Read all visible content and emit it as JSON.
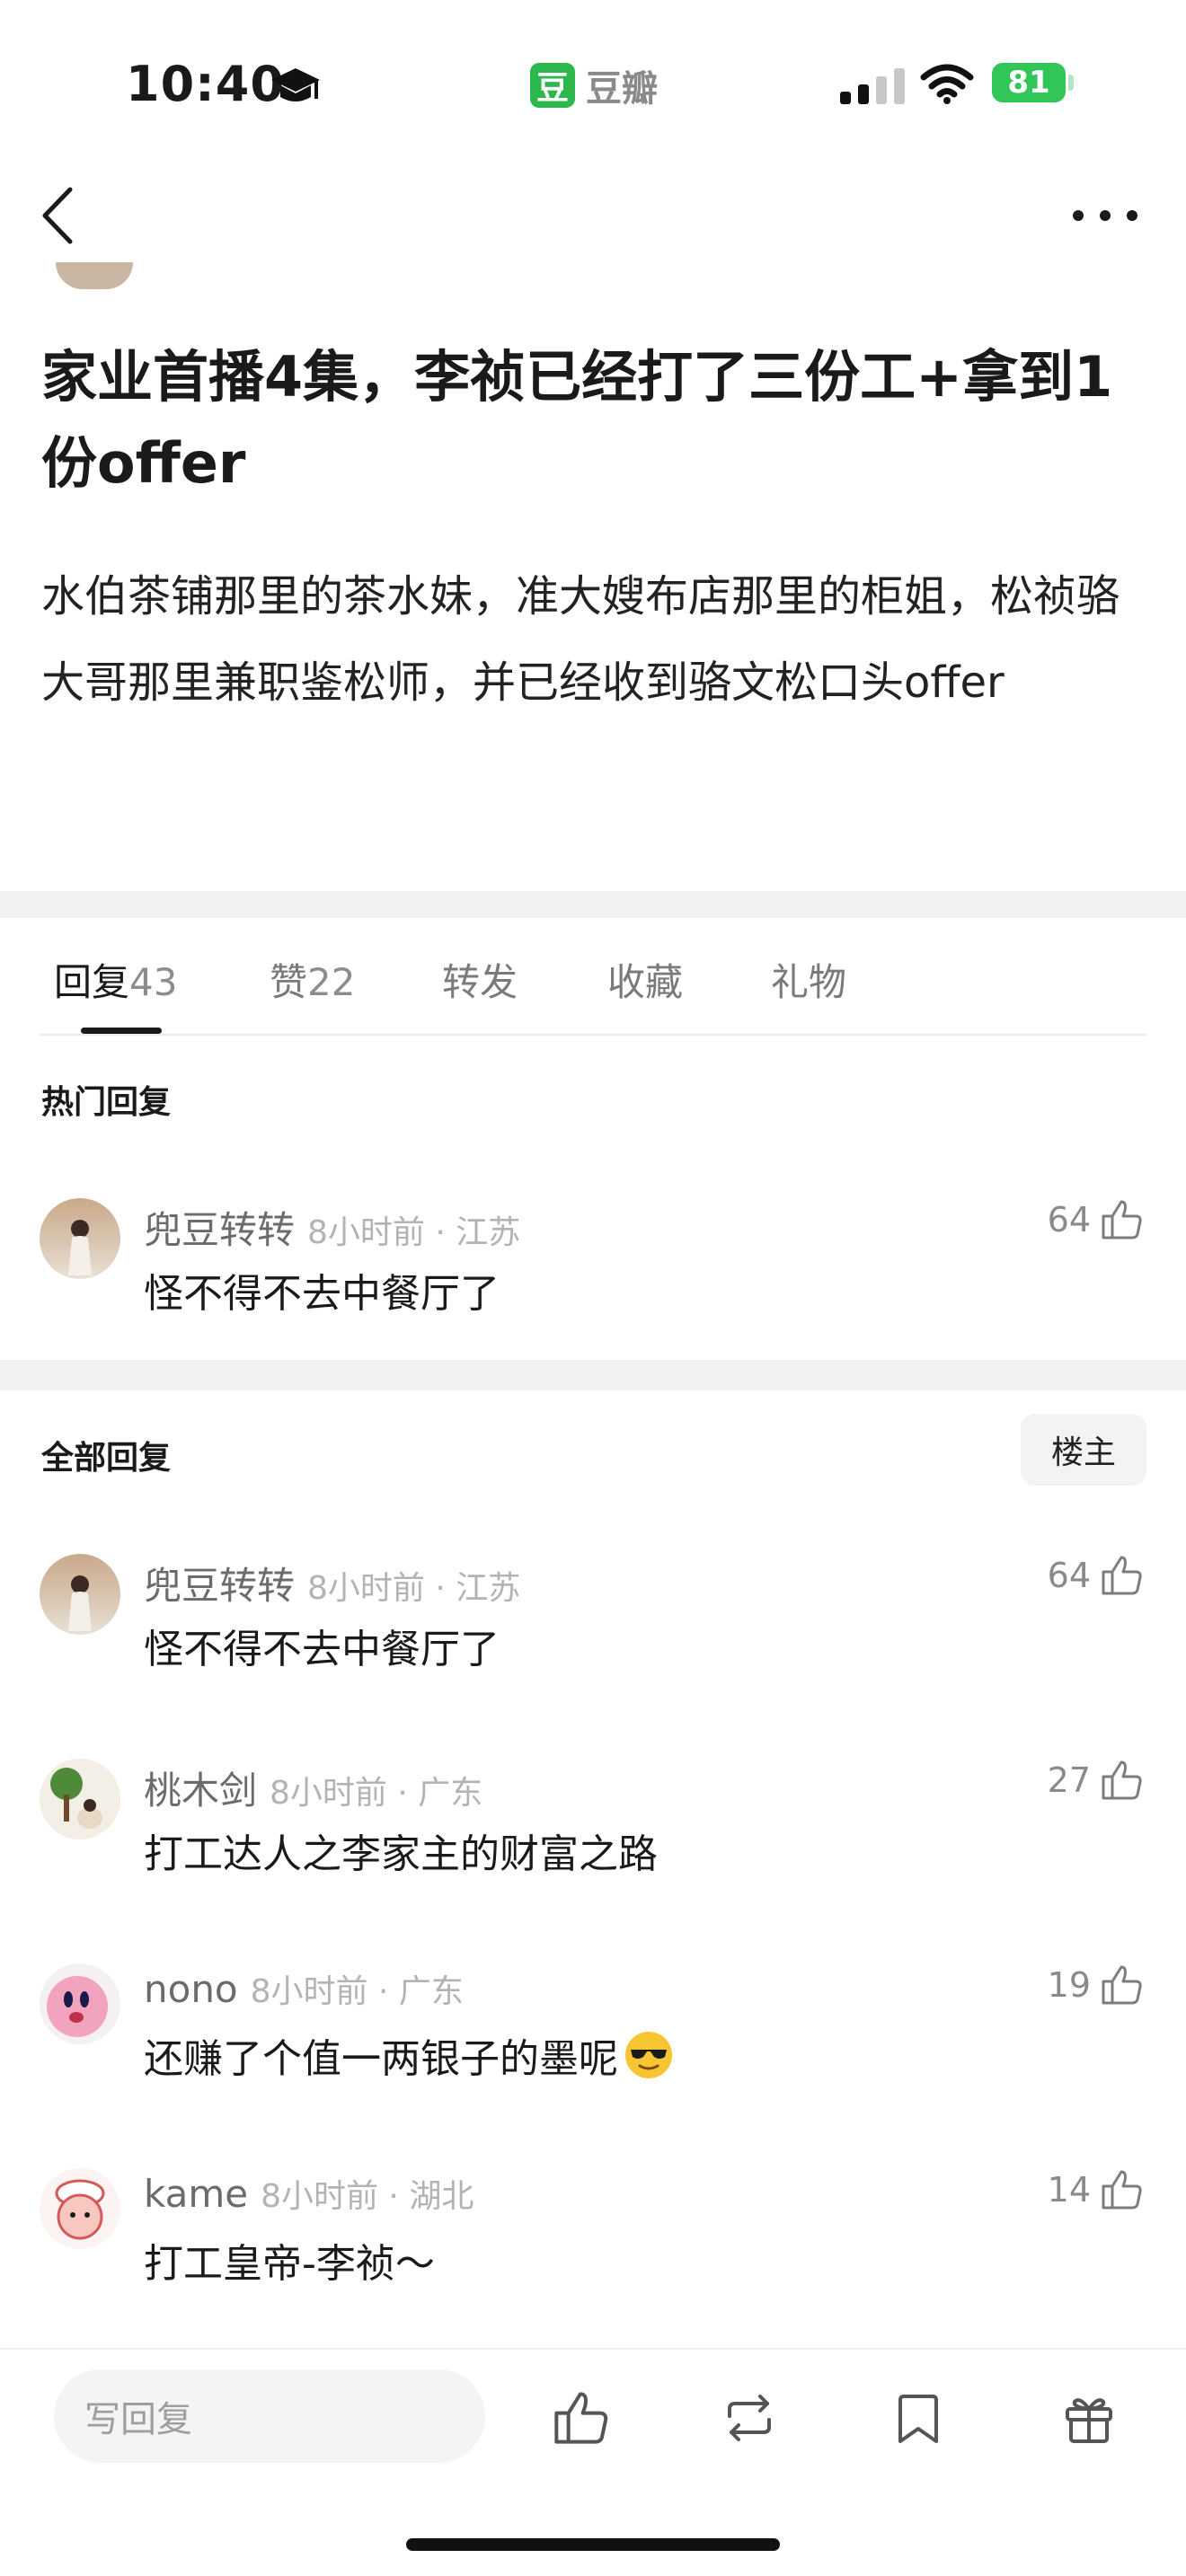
{
  "status_bar": {
    "time": "10:40",
    "app_name": "豆瓣",
    "app_badge": "豆",
    "battery": "81"
  },
  "nav": {
    "back_icon": "chevron-left-icon",
    "more_icon": "more-icon"
  },
  "post": {
    "title": "家业首播4集，李祯已经打了三份工+拿到1份offer",
    "body": "水伯茶铺那里的茶水妹，准大嫂布店那里的柜姐，松祯骆大哥那里兼职鉴松师，并已经收到骆文松口头offer"
  },
  "tabs": [
    {
      "label": "回复",
      "count": "43"
    },
    {
      "label": "赞",
      "count": "22"
    },
    {
      "label": "转发"
    },
    {
      "label": "收藏"
    },
    {
      "label": "礼物"
    }
  ],
  "hot_section": {
    "label": "热门回复",
    "comments": [
      {
        "name": "兜豆转转",
        "meta": "8小时前 · 江苏",
        "text": "怪不得不去中餐厅了",
        "likes": "64"
      }
    ]
  },
  "all_section": {
    "label": "全部回复",
    "op_button": "楼主",
    "comments": [
      {
        "name": "兜豆转转",
        "meta": "8小时前 · 江苏",
        "text": "怪不得不去中餐厅了",
        "likes": "64"
      },
      {
        "name": "桃木剑",
        "meta": "8小时前 · 广东",
        "text": "打工达人之李家主的财富之路",
        "likes": "27"
      },
      {
        "name": "nono",
        "meta": "8小时前 · 广东",
        "text": "还赚了个值一两银子的墨呢",
        "likes": "19"
      },
      {
        "name": "kame",
        "meta": "8小时前 · 湖北",
        "text": "打工皇帝-李祯～",
        "likes": "14"
      }
    ]
  },
  "bottom_bar": {
    "reply_placeholder": "写回复"
  },
  "colors": {
    "brand_green": "#2db84d",
    "battery_green": "#32c659",
    "separator": "#f2f2f2"
  }
}
